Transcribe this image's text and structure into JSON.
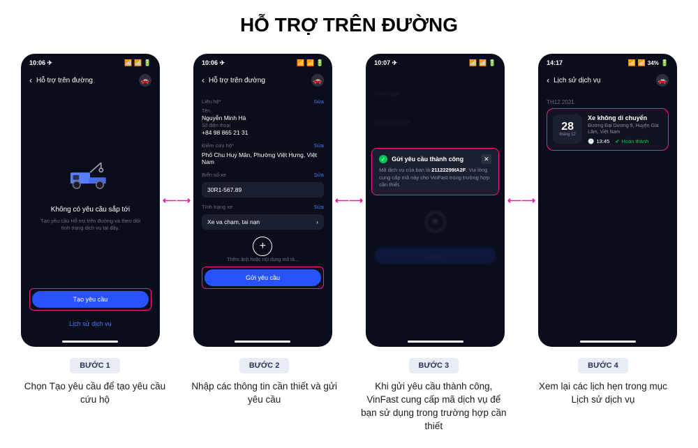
{
  "page_title": "HỖ TRỢ TRÊN ĐƯỜNG",
  "screen1": {
    "time": "10:06",
    "header": "Hỗ trợ trên đường",
    "no_request_title": "Không có yêu cầu sắp tới",
    "no_request_sub": "Tạo yêu cầu Hỗ trợ trên đường và theo dõi tình trạng dịch vụ tại đây.",
    "create_btn": "Tạo yêu cầu",
    "history_link": "Lịch sử dịch vụ"
  },
  "screen2": {
    "time": "10:06",
    "header": "Hỗ trợ trên đường",
    "contact_label": "Liên hệ*",
    "edit": "Sửa",
    "name_label": "Tên",
    "name_value": "Nguyễn Minh Hà",
    "phone_label": "Số điện thoại",
    "phone_value": "+84 98 865 21 31",
    "rescue_label": "Điểm cứu hộ*",
    "rescue_value": "Phố Chu Huy Mân, Phường Việt Hưng, Việt Nam",
    "plate_label": "Biển số xe",
    "plate_value": "30R1-567.89",
    "condition_label": "Tình trạng xe",
    "condition_value": "Xe va chạm, tai nạn",
    "add_label": "Thêm ảnh hoặc nội dung mô tả...",
    "send_btn": "Gửi yêu cầu"
  },
  "screen3": {
    "time": "10:07",
    "toast_title": "Gửi yêu cầu thành công",
    "toast_body_pre": "Mã dịch vụ của bạn là ",
    "toast_code": "21122299IA2F",
    "toast_body_post": ". Vui lòng cung cấp mã này cho VinFast trong trường hợp cần thiết."
  },
  "screen4": {
    "time": "14:17",
    "battery": "34%",
    "header": "Lịch sử dịch vụ",
    "month": "TH12 2021",
    "date_day": "28",
    "date_month": "tháng 12",
    "card_title": "Xe không di chuyển",
    "card_addr": "Đường Đại Dương 9, Huyện Gia Lâm, Việt Nam",
    "card_time": "13:45",
    "card_status": "Hoàn thành"
  },
  "steps": {
    "b1": "BƯỚC 1",
    "d1": "Chọn Tạo yêu cầu để tạo yêu cầu cứu hộ",
    "b2": "BƯỚC 2",
    "d2": "Nhập các thông tin cần thiết và gửi yêu cầu",
    "b3": "BƯỚC 3",
    "d3": "Khi gửi yêu cầu thành công, VinFast cung cấp mã dịch vụ để bạn sử dụng trong trường hợp cần thiết",
    "b4": "BƯỚC 4",
    "d4": "Xem lại các lịch hẹn trong mục Lịch sử dịch vụ"
  }
}
